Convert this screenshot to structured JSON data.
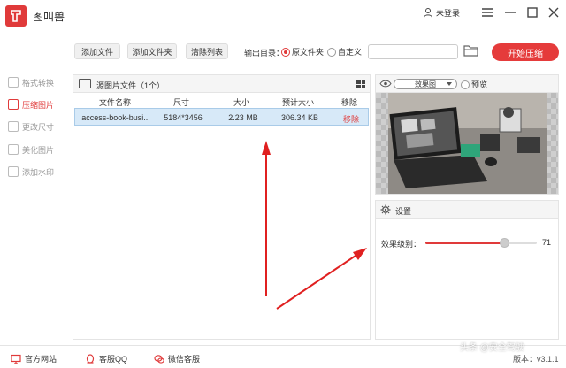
{
  "app": {
    "title": "图叫兽"
  },
  "titlebar": {
    "login_label": "未登录"
  },
  "sidebar": {
    "items": [
      {
        "label": "格式转换",
        "active": false
      },
      {
        "label": "压缩图片",
        "active": true
      },
      {
        "label": "更改尺寸",
        "active": false
      },
      {
        "label": "美化图片",
        "active": false
      },
      {
        "label": "添加水印",
        "active": false
      }
    ]
  },
  "toolbar": {
    "add_file": "添加文件",
    "add_folder": "添加文件夹",
    "clear_list": "清除列表",
    "output_label": "输出目录：",
    "option_source": "原文件夹",
    "option_custom": "自定义",
    "path_value": "",
    "start_label": "开始压缩"
  },
  "file_panel": {
    "title": "源图片文件（1个）",
    "columns": [
      "文件名称",
      "尺寸",
      "大小",
      "预计大小",
      "移除"
    ],
    "rows": [
      {
        "name": "access-book-busi...",
        "size": "5184*3456",
        "filesize": "2.23 MB",
        "estimated": "306.34 KB",
        "remove": "移除"
      }
    ]
  },
  "preview": {
    "mode": "效果图",
    "preview_label": "预览"
  },
  "settings": {
    "title": "设置",
    "level_label": "效果级别：",
    "level_value": "71",
    "level_fraction": 0.71
  },
  "statusbar": {
    "website": "官方网站",
    "qq": "客服QQ",
    "wechat": "微信客服",
    "version": "版本：v3.1.1"
  },
  "watermark": "头条 @安全驾驶",
  "colors": {
    "accent": "#e03a3a",
    "selected_row": "#d7e9f8"
  }
}
